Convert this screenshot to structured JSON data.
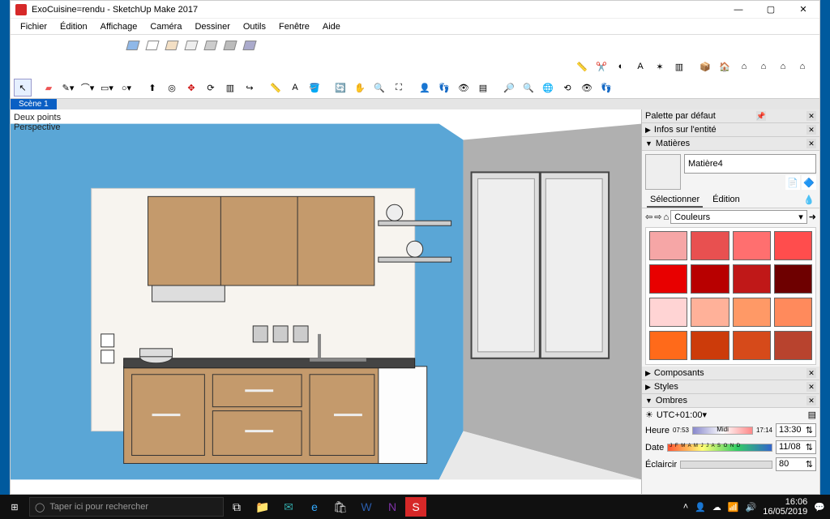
{
  "titlebar": {
    "title": "ExoCuisine=rendu - SketchUp Make 2017"
  },
  "menubar": [
    "Fichier",
    "Édition",
    "Affichage",
    "Caméra",
    "Dessiner",
    "Outils",
    "Fenêtre",
    "Aide"
  ],
  "scene_tab": "Scène 1",
  "overlay": {
    "line1": "Deux points",
    "line2": "Perspective"
  },
  "panels": {
    "default_palette": "Palette par défaut",
    "entity_info": "Infos sur l'entité",
    "materials": "Matières",
    "components": "Composants",
    "styles": "Styles",
    "shadows": "Ombres",
    "lighten": "Éclaircir"
  },
  "material": {
    "name": "Matière4",
    "tab_select": "Sélectionner",
    "tab_edit": "Édition",
    "combo": "Couleurs"
  },
  "swatches": [
    "#f6a6a6",
    "#e85050",
    "#ff6f6f",
    "#ff4d4d",
    "#e80000",
    "#b80000",
    "#c01818",
    "#6e0000",
    "#ffd4d4",
    "#ffb199",
    "#ff9966",
    "#ff8a5c",
    "#ff6a1a",
    "#cc3b0a",
    "#d64a1a",
    "#b8432e"
  ],
  "shadows": {
    "tz": "UTC+01:00",
    "heure_start": "07:53",
    "heure_mid": "Midi",
    "heure_end": "17:14",
    "heure_val": "13:30",
    "date_months": "J F M A M J J A S O N D",
    "date_val": "11/08",
    "lighten_val": "80"
  },
  "taskbar": {
    "search": "Taper ici pour rechercher",
    "time": "16:06",
    "date": "16/05/2019"
  }
}
